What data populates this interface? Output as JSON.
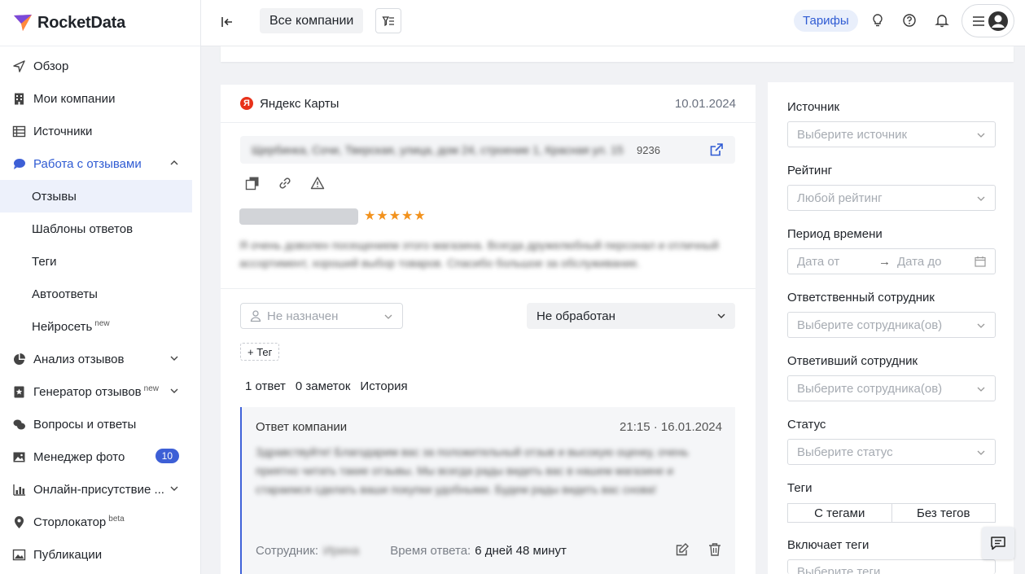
{
  "brand": {
    "name": "RocketData"
  },
  "sidebar": {
    "items": [
      {
        "label": "Обзор",
        "icon": "send-icon"
      },
      {
        "label": "Мои компании",
        "icon": "building-icon"
      },
      {
        "label": "Источники",
        "icon": "list-icon"
      },
      {
        "label": "Работа с отзывами",
        "icon": "chat-bubble-icon"
      },
      {
        "label": "Анализ отзывов",
        "icon": "pie-chart-icon"
      },
      {
        "label": "Генератор отзывов",
        "icon": "star-box-icon",
        "tag": "new"
      },
      {
        "label": "Вопросы и ответы",
        "icon": "chat-icon"
      },
      {
        "label": "Менеджер фото",
        "icon": "image-icon",
        "badge": "10"
      },
      {
        "label": "Онлайн-присутствие ...",
        "icon": "bar-chart-icon"
      },
      {
        "label": "Сторлокатор",
        "icon": "map-pin-icon",
        "tag": "beta"
      },
      {
        "label": "Публикации",
        "icon": "picture-icon"
      }
    ],
    "sub_items": [
      {
        "label": "Отзывы"
      },
      {
        "label": "Шаблоны ответов"
      },
      {
        "label": "Теги"
      },
      {
        "label": "Автоответы"
      },
      {
        "label": "Нейросеть",
        "tag": "new"
      }
    ]
  },
  "header": {
    "company_selector": "Все компании",
    "tariff": "Тарифы"
  },
  "review": {
    "source": "Яндекс Карты",
    "source_logo_letter": "Я",
    "date": "10.01.2024",
    "address_blurred": "Щербинка, Сочи, Тверская, улица, дом 24, строение 1, Красная ул. 15",
    "address_code": "9236",
    "stars": "★★★★★",
    "text_blurred": "Я очень доволен посещением этого магазина. Всегда дружелюбный персонал и отличный ассортимент, хороший выбор товаров. Спасибо большое за обслуживание.",
    "assignee_placeholder": "Не назначен",
    "status": "Не обработан",
    "tag_button": "+ Тег",
    "tabs": [
      "1 ответ",
      "0 заметок",
      "История"
    ]
  },
  "answer": {
    "title": "Ответ компании",
    "time": "21:15 · 16.01.2024",
    "text_blurred": "Здравствуйте! Благодарим вас за положительный отзыв и высокую оценку, очень приятно читать такие отзывы. Мы всегда рады видеть вас в нашем магазине и стараемся сделать ваши покупки удобными. Будем рады видеть вас снова!",
    "employee_label": "Сотрудник:",
    "employee_blurred": "Ирина",
    "response_time_label": "Время ответа:",
    "response_time_value": "6 дней 48 минут"
  },
  "filters": {
    "source_label": "Источник",
    "source_placeholder": "Выберите источник",
    "rating_label": "Рейтинг",
    "rating_placeholder": "Любой рейтинг",
    "period_label": "Период времени",
    "date_from": "Дата от",
    "date_to": "Дата до",
    "responsible_label": "Ответственный сотрудник",
    "responsible_placeholder": "Выберите сотрудника(ов)",
    "replied_label": "Ответивший сотрудник",
    "replied_placeholder": "Выберите сотрудника(ов)",
    "status_label": "Статус",
    "status_placeholder": "Выберите статус",
    "tags_label": "Теги",
    "tags_with": "С тегами",
    "tags_without": "Без тегов",
    "includes_tags_label": "Включает теги",
    "includes_tags_placeholder": "Выберите теги"
  },
  "colors": {
    "accent": "#2f5bd3",
    "star": "#f2921d",
    "yandex": "#e8311a"
  }
}
